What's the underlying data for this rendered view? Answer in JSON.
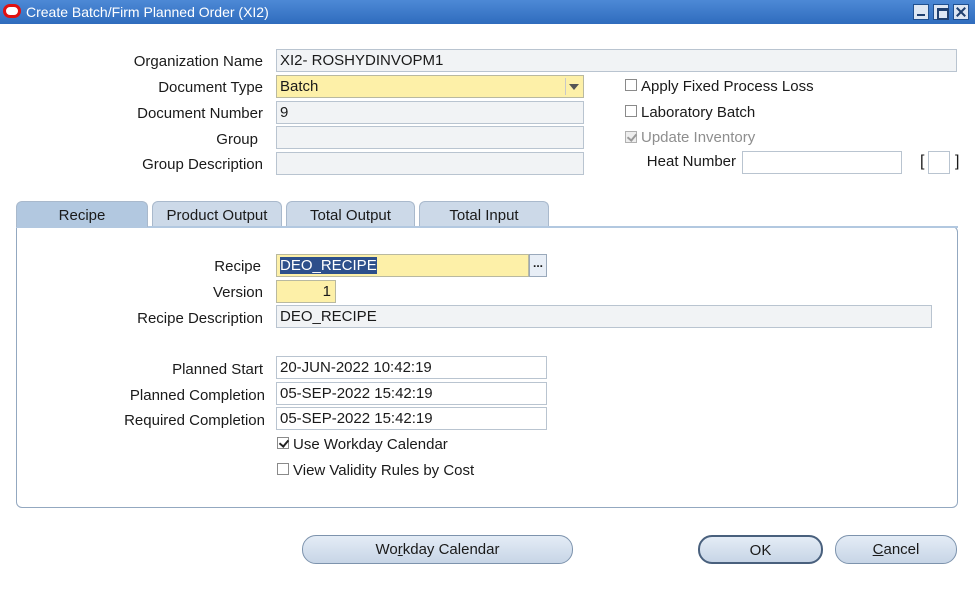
{
  "window": {
    "title": "Create Batch/Firm Planned Order (XI2)"
  },
  "header": {
    "organization_name_label": "Organization Name",
    "organization_name_value": "XI2- ROSHYDINVOPM1",
    "document_type_label": "Document Type",
    "document_type_value": "Batch",
    "document_number_label": "Document Number",
    "document_number_value": "9",
    "group_label": "Group",
    "group_value": "",
    "group_description_label": "Group Description",
    "group_description_value": "",
    "apply_fixed_process_loss_label": "Apply Fixed Process Loss",
    "apply_fixed_process_loss_checked": false,
    "laboratory_batch_label": "Laboratory Batch",
    "laboratory_batch_checked": false,
    "update_inventory_label": "Update Inventory",
    "update_inventory_checked": true,
    "heat_number_label": "Heat Number",
    "heat_number_value": "",
    "bracket_open": "[",
    "bracket_close": "]"
  },
  "tabs": [
    {
      "label": "Recipe",
      "active": true
    },
    {
      "label": "Product Output",
      "active": false
    },
    {
      "label": "Total Output",
      "active": false
    },
    {
      "label": "Total Input",
      "active": false
    }
  ],
  "recipe_tab": {
    "recipe_label": "Recipe",
    "recipe_value": "DEO_RECIPE",
    "lov_button_label": "...",
    "version_label": "Version",
    "version_value": "1",
    "recipe_description_label": "Recipe Description",
    "recipe_description_value": "DEO_RECIPE",
    "planned_start_label": "Planned Start",
    "planned_start_value": "20-JUN-2022 10:42:19",
    "planned_completion_label": "Planned Completion",
    "planned_completion_value": "05-SEP-2022 15:42:19",
    "required_completion_label": "Required Completion",
    "required_completion_value": "05-SEP-2022 15:42:19",
    "use_workday_calendar_label": "Use Workday Calendar",
    "use_workday_calendar_checked": true,
    "view_validity_rules_label": "View Validity Rules by Cost",
    "view_validity_rules_checked": false
  },
  "buttons": {
    "workday_calendar_pre": "Wo",
    "workday_calendar_mnemonic": "r",
    "workday_calendar_post": "kday Calendar",
    "ok": "OK",
    "cancel_mnemonic": "C",
    "cancel_post": "ancel"
  },
  "colors": {
    "titlebar": "#3b79c6",
    "required_field": "#fdf0a8",
    "active_tab": "#b2c8e0"
  }
}
